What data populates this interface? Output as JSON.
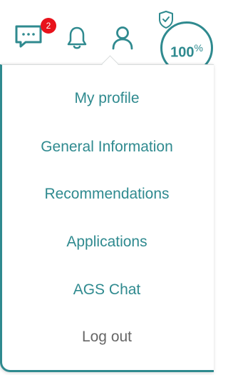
{
  "header": {
    "chat_icon": "chat-bubble-icon",
    "notification_badge": "2",
    "bell_icon": "bell-icon",
    "user_icon": "user-icon",
    "score": {
      "value": "100",
      "unit": "%",
      "shield_icon": "shield-check-icon"
    }
  },
  "colors": {
    "accent": "#2f8a8f",
    "badge": "#e8121b",
    "logout_text": "#666666"
  },
  "menu": {
    "items": [
      {
        "label": "My profile"
      },
      {
        "label": "General Information"
      },
      {
        "label": "Recommendations"
      },
      {
        "label": "Applications"
      },
      {
        "label": "AGS Chat"
      },
      {
        "label": "Log out"
      }
    ]
  }
}
